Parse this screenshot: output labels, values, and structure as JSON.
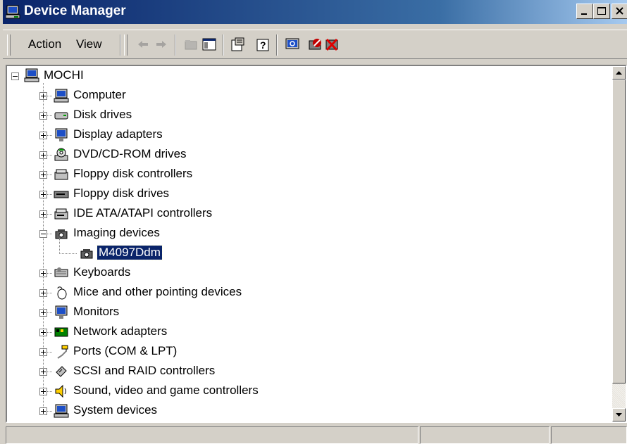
{
  "window": {
    "title": "Device Manager",
    "controls": {
      "minimize": "minimize",
      "maximize": "maximize",
      "close": "close"
    }
  },
  "menu": {
    "action": "Action",
    "view": "View"
  },
  "toolbar": {
    "tools": [
      "back-icon",
      "forward-icon",
      "up-folder-icon",
      "show-hide-tree-icon",
      "properties-icon",
      "help-icon",
      "scan-hardware-icon",
      "disable-device-icon",
      "uninstall-device-icon"
    ]
  },
  "tree": {
    "root": "MOCHI",
    "categories": [
      {
        "label": "Computer",
        "icon": "computer-icon"
      },
      {
        "label": "Disk drives",
        "icon": "disk-drive-icon"
      },
      {
        "label": "Display adapters",
        "icon": "display-adapter-icon"
      },
      {
        "label": "DVD/CD-ROM drives",
        "icon": "cdrom-icon"
      },
      {
        "label": "Floppy disk controllers",
        "icon": "controller-icon"
      },
      {
        "label": "Floppy disk drives",
        "icon": "floppy-drive-icon"
      },
      {
        "label": "IDE ATA/ATAPI controllers",
        "icon": "ide-controller-icon"
      },
      {
        "label": "Imaging devices",
        "icon": "imaging-device-icon",
        "expanded": true,
        "children": [
          {
            "label": "M4097Ddm",
            "icon": "camera-icon",
            "selected": true
          }
        ]
      },
      {
        "label": "Keyboards",
        "icon": "keyboard-icon"
      },
      {
        "label": "Mice and other pointing devices",
        "icon": "mouse-icon"
      },
      {
        "label": "Monitors",
        "icon": "monitor-icon"
      },
      {
        "label": "Network adapters",
        "icon": "network-adapter-icon"
      },
      {
        "label": "Ports (COM & LPT)",
        "icon": "port-icon"
      },
      {
        "label": "SCSI and RAID controllers",
        "icon": "scsi-icon"
      },
      {
        "label": "Sound, video and game controllers",
        "icon": "sound-icon"
      },
      {
        "label": "System devices",
        "icon": "system-device-icon"
      }
    ]
  },
  "colors": {
    "titlebar_start": "#0a246a",
    "titlebar_end": "#a6caf0",
    "selection": "#0a246a",
    "chrome": "#d4d0c8"
  }
}
